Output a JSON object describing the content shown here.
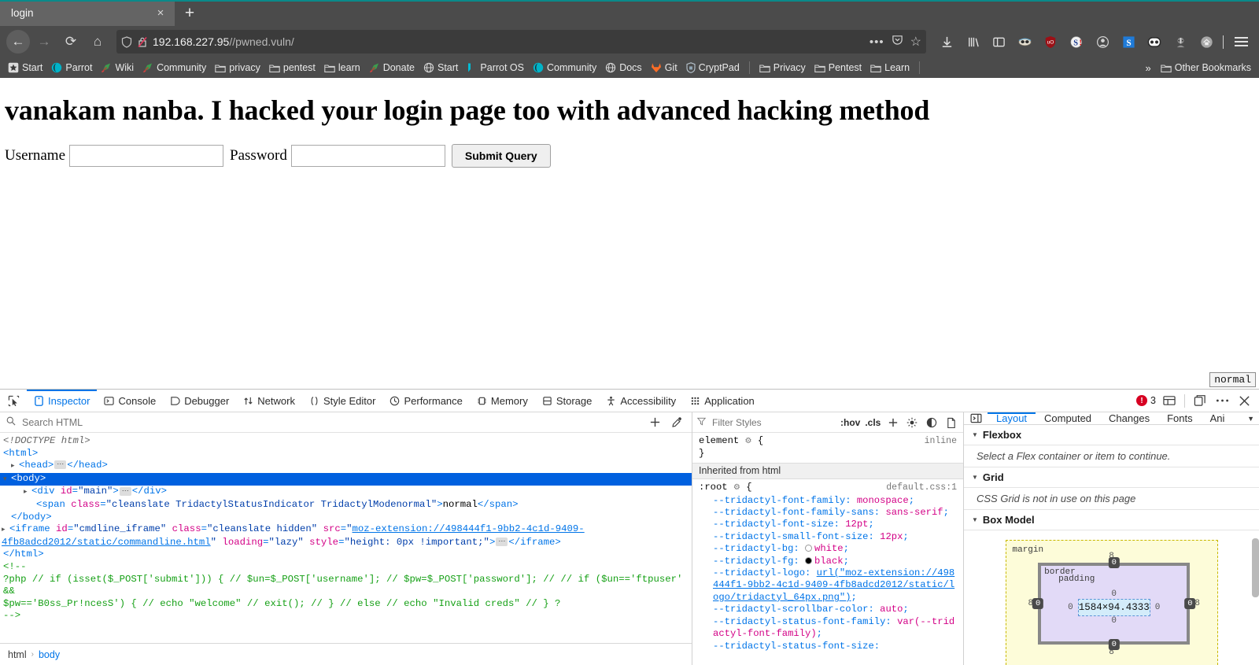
{
  "browser": {
    "tab": {
      "title": "login",
      "close_label": "×"
    },
    "new_tab_label": "+",
    "nav": {
      "back": "←",
      "forward": "→",
      "reload": "⟳",
      "home": "⌂"
    },
    "url": {
      "value": "192.168.227.95",
      "path": "//pwned.vuln/",
      "shield_icon": "shield-icon",
      "broken_lock_icon": "broken-lock-icon",
      "ellipsis": "•••",
      "pocket_icon": "pocket-icon",
      "star_icon": "☆"
    },
    "toolbar_icons": [
      {
        "name": "downloads-icon",
        "glyph": "↓"
      },
      {
        "name": "library-icon",
        "glyph": "‖"
      },
      {
        "name": "sidebar-icon",
        "glyph": "◫"
      },
      {
        "name": "extension-hacker-icon",
        "glyph": ""
      },
      {
        "name": "ublock-origin-icon",
        "glyph": "uO"
      },
      {
        "name": "sysinternals-icon",
        "glyph": "S!"
      },
      {
        "name": "account-icon",
        "glyph": "○"
      },
      {
        "name": "s-blue-icon",
        "glyph": "S"
      },
      {
        "name": "dark-reader-icon",
        "glyph": "◑"
      },
      {
        "name": "privacy-badger-icon",
        "glyph": ""
      },
      {
        "name": "home-gray-icon",
        "glyph": ""
      }
    ],
    "menu_icon": "hamburger-menu-icon",
    "bookmarks": [
      {
        "label": "Start",
        "icon": "star-box-icon"
      },
      {
        "label": "Parrot",
        "icon": "parrot-icon"
      },
      {
        "label": "Wiki",
        "icon": "parrot-feather-icon"
      },
      {
        "label": "Community",
        "icon": "parrot-feather-icon"
      },
      {
        "label": "privacy",
        "icon": "folder-icon"
      },
      {
        "label": "pentest",
        "icon": "folder-icon"
      },
      {
        "label": "learn",
        "icon": "folder-icon"
      },
      {
        "label": "Donate",
        "icon": "parrot-feather-icon"
      },
      {
        "label": "Start",
        "icon": "globe-icon"
      },
      {
        "label": "Parrot OS",
        "icon": "parrot-os-icon"
      },
      {
        "label": "Community",
        "icon": "parrot-icon"
      },
      {
        "label": "Docs",
        "icon": "globe-icon"
      },
      {
        "label": "Git",
        "icon": "gitlab-icon"
      },
      {
        "label": "CryptPad",
        "icon": "cryptpad-icon"
      },
      {
        "label": "Privacy",
        "icon": "folder-icon"
      },
      {
        "label": "Pentest",
        "icon": "folder-icon"
      },
      {
        "label": "Learn",
        "icon": "folder-icon"
      }
    ],
    "bookmarks_overflow": "»",
    "other_bookmarks": "Other Bookmarks"
  },
  "page": {
    "heading": "vanakam nanba. I hacked your login page too with advanced hacking method",
    "form": {
      "username_label": "Username",
      "username_value": "",
      "password_label": "Password",
      "password_value": "",
      "submit_label": "Submit Query"
    },
    "tridactyl_status": "normal"
  },
  "devtools": {
    "tabs": [
      {
        "label": "Inspector",
        "icon": "inspector-icon",
        "active": true
      },
      {
        "label": "Console",
        "icon": "console-icon",
        "active": false
      },
      {
        "label": "Debugger",
        "icon": "debugger-icon",
        "active": false
      },
      {
        "label": "Network",
        "icon": "network-icon",
        "active": false
      },
      {
        "label": "Style Editor",
        "icon": "style-editor-icon",
        "active": false
      },
      {
        "label": "Performance",
        "icon": "performance-icon",
        "active": false
      },
      {
        "label": "Memory",
        "icon": "memory-icon",
        "active": false
      },
      {
        "label": "Storage",
        "icon": "storage-icon",
        "active": false
      },
      {
        "label": "Accessibility",
        "icon": "accessibility-icon",
        "active": false
      },
      {
        "label": "Application",
        "icon": "application-icon",
        "active": false
      }
    ],
    "error_count": "3",
    "right_icons": [
      {
        "name": "responsive-design-mode-icon"
      },
      {
        "name": "detach-devtools-icon"
      },
      {
        "name": "devtools-meatball-menu-icon"
      },
      {
        "name": "close-devtools-icon"
      }
    ],
    "markup": {
      "search_placeholder": "Search HTML",
      "add_node_icon": "add-node-icon",
      "eyedropper_icon": "eyedropper-icon",
      "lines": {
        "doctype": "<!DOCTYPE html>",
        "html_open": "<html>",
        "head": "<head>",
        "head_close": "</head>",
        "body_open": "<body>",
        "div_main": "<div id=\"main\">",
        "div_main_close": "</div>",
        "span_open": "<span class=\"cleanslate TridactylStatusIndicator TridactylModenormal\">",
        "span_text": "normal",
        "span_close": "</span>",
        "body_close": "</body>",
        "iframe_open": "<iframe id=\"cmdline_iframe\" class=\"cleanslate hidden\" src=\"",
        "iframe_src": "moz-extension://498444f1-9bb2-4c1d-9409-4fb8adcd2012/static/commandline.html",
        "iframe_rest": "\" loading=\"lazy\" style=\"height: 0px !important;\">",
        "iframe_close": "</iframe>",
        "html_close": "</html>",
        "comment_open": "<!--",
        "comment_line1": "?php // if (isset($_POST['submit'])) { // $un=$_POST['username']; // $pw=$_POST['password']; // // if ($un=='ftpuser' &&",
        "comment_line2": "$pw=='B0ss_Pr!ncesS') { // echo \"welcome\" // exit(); // } // else // echo \"Invalid creds\" // } ?",
        "comment_close": "-->"
      },
      "breadcrumb": [
        {
          "label": "html",
          "current": false
        },
        {
          "label": "body",
          "current": true
        }
      ],
      "breadcrumb_sep": "›"
    },
    "rules": {
      "filter_placeholder": "Filter Styles",
      "hov_label": ":hov",
      "cls_label": ".cls",
      "add_rule_icon": "add-rule-icon",
      "light_scheme_icon": "light-color-scheme-icon",
      "dark_scheme_icon": "dark-color-scheme-icon",
      "print_media_icon": "print-media-icon",
      "element_rule": {
        "selector": "element",
        "source": "inline",
        "close": "}"
      },
      "inherited_label": "Inherited from html",
      "root_rule": {
        "selector": ":root",
        "source": "default.css:1",
        "declarations": [
          {
            "prop": "--tridactyl-font-family",
            "value": "monospace",
            "swatch": null
          },
          {
            "prop": "--tridactyl-font-family-sans",
            "value": "sans-serif",
            "swatch": null
          },
          {
            "prop": "--tridactyl-font-size",
            "value": "12pt",
            "swatch": null
          },
          {
            "prop": "--tridactyl-small-font-size",
            "value": "12px",
            "swatch": null
          },
          {
            "prop": "--tridactyl-bg",
            "value": "white",
            "swatch": "#ffffff"
          },
          {
            "prop": "--tridactyl-fg",
            "value": "black",
            "swatch": "#000000"
          },
          {
            "prop": "--tridactyl-logo",
            "value": "url(\"moz-extension://498444f1-9bb2-4c1d-9409-4fb8adcd2012/static/logo/tridactyl_64px.png\")",
            "swatch": null,
            "is_link": true
          },
          {
            "prop": "--tridactyl-scrollbar-color",
            "value": "auto",
            "swatch": null
          },
          {
            "prop": "--tridactyl-status-font-family",
            "value": "var(--tridactyl-font-family)",
            "swatch": null
          },
          {
            "prop": "--tridactyl-status-font-size",
            "value": "",
            "swatch": null
          }
        ]
      }
    },
    "layout": {
      "tabs": [
        {
          "label": "Layout",
          "active": true
        },
        {
          "label": "Computed",
          "active": false
        },
        {
          "label": "Changes",
          "active": false
        },
        {
          "label": "Fonts",
          "active": false
        },
        {
          "label": "Ani",
          "active": false
        }
      ],
      "expand_icon": "expand-pane-icon",
      "more_icon": "more-tabs-chevron-icon",
      "sections": [
        {
          "title": "Flexbox",
          "note": "Select a Flex container or item to continue."
        },
        {
          "title": "Grid",
          "note": "CSS Grid is not in use on this page"
        },
        {
          "title": "Box Model",
          "note": ""
        }
      ],
      "box_model": {
        "margin_label": "margin",
        "border_label": "border",
        "padding_label": "padding",
        "content_size": "1584×94.4333",
        "margin_top": "8",
        "margin_right": "8",
        "margin_bottom": "8",
        "margin_left": "8",
        "border_top": "0",
        "border_right": "0",
        "border_bottom": "0",
        "border_left": "0",
        "padding_top": "0",
        "padding_right": "0",
        "padding_bottom": "0",
        "padding_left": "0"
      }
    }
  }
}
